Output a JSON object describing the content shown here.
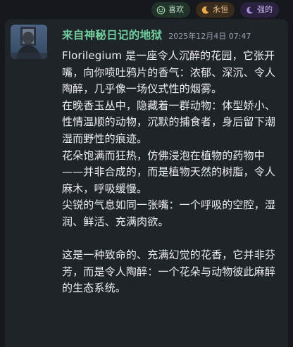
{
  "reactions": [
    {
      "icon": "smile-icon",
      "label": "喜欢"
    },
    {
      "icon": "moon-icon",
      "label": "永恒"
    },
    {
      "icon": "crescent-icon",
      "label": "强的"
    }
  ],
  "message": {
    "author": "来自神秘日记的地狱",
    "timestamp": "2025年12月4日 07:47",
    "paragraphs": [
      "Florilegium 是一座令人沉醉的花园，它张开嘴，向你喷吐鸦片的香气：浓郁、深沉、令人陶醉，几乎像一场仪式性的烟雾。",
      "在晚香玉丛中，隐藏着一群动物：体型娇小、性情温顺的动物，沉默的捕食者，身后留下潮湿而野性的痕迹。",
      "花朵饱满而狂热，仿佛浸泡在植物的药物中——并非合成的，而是植物天然的树脂，令人麻木，呼吸缓慢。",
      "尖锐的气息如同一张嘴：一个呼吸的空腔，湿润、鲜活、充满肉欲。",
      "",
      "这是一种致命的、充满幻觉的花香，它并非芬芳，而是令人陶醉：一个花朵与动物彼此麻醉的生态系统。"
    ]
  },
  "colors": {
    "background": "#15191e",
    "card": "#1f2429",
    "author": "#71cfa0",
    "timestamp": "#9aa2ab",
    "text": "#eceef1"
  }
}
